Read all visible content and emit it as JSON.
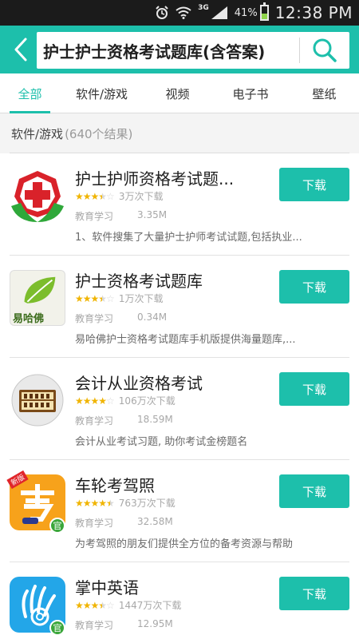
{
  "status_bar": {
    "network": "3G",
    "battery_percent_text": "41%",
    "battery_level": 0.41,
    "time": "12:38 PM"
  },
  "search": {
    "query": "护士护士资格考试题库(含答案)",
    "back_icon": "chevron-left-icon",
    "search_icon": "search-icon"
  },
  "tabs": [
    {
      "label": "全部",
      "active": true
    },
    {
      "label": "软件/游戏",
      "active": false
    },
    {
      "label": "视频",
      "active": false
    },
    {
      "label": "电子书",
      "active": false
    },
    {
      "label": "壁纸",
      "active": false
    }
  ],
  "results": {
    "category": "软件/游戏",
    "count_text": "(640个结果)"
  },
  "apps": [
    {
      "name": "护士护师资格考试题...",
      "rating": 3.5,
      "downloads": "3万次下载",
      "category": "教育学习",
      "size": "3.35M",
      "description": "1、软件搜集了大量护士护师考试试题,包括执业...",
      "button": "下载",
      "icon": "red-cross-hands-icon"
    },
    {
      "name": "护士资格考试题库",
      "rating": 3.5,
      "downloads": "1万次下载",
      "category": "教育学习",
      "size": "0.34M",
      "description": "易哈佛护士资格考试题库手机版提供海量题库,...",
      "button": "下载",
      "icon": "yihafo-leaf-icon",
      "icon_text": "易哈佛"
    },
    {
      "name": "会计从业资格考试",
      "rating": 4,
      "downloads": "106万次下载",
      "category": "教育学习",
      "size": "18.59M",
      "description": "会计从业考试习题, 助你考试金榜题名",
      "button": "下载",
      "icon": "abacus-icon"
    },
    {
      "name": "车轮考驾照",
      "rating": 4.5,
      "downloads": "763万次下载",
      "category": "教育学习",
      "size": "32.58M",
      "description": "为考驾照的朋友们提供全方位的备考资源与帮助",
      "button": "下载",
      "icon": "chelun-kao-icon",
      "badge_new": "新版",
      "badge_official": "官"
    },
    {
      "name": "掌中英语",
      "rating": 3.5,
      "downloads": "1447万次下载",
      "category": "教育学习",
      "size": "12.95M",
      "description": "",
      "button": "下载",
      "icon": "hand-swirl-icon",
      "badge_official": "官"
    }
  ],
  "colors": {
    "accent": "#1dbfab",
    "status_bar": "#1b1b1b",
    "star": "#f0b400"
  }
}
